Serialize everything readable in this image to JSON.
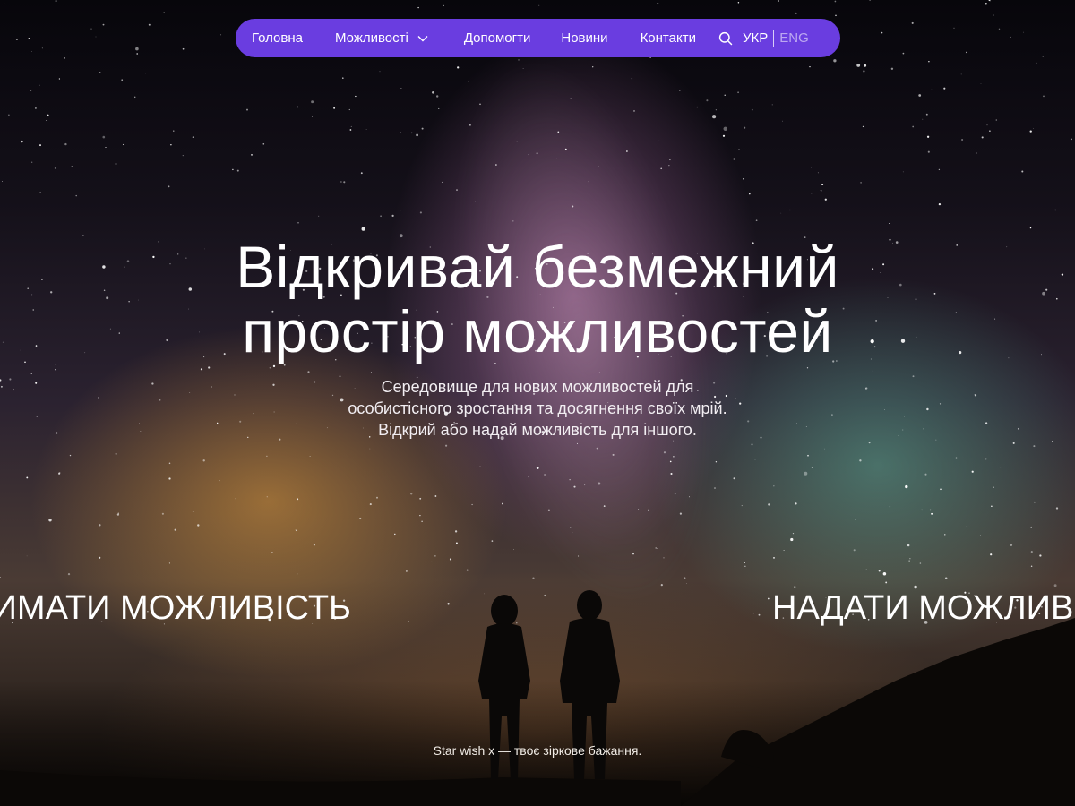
{
  "nav": {
    "items": [
      {
        "label": "Головна"
      },
      {
        "label": "Можливості"
      },
      {
        "label": "Допомогти"
      },
      {
        "label": "Новини"
      },
      {
        "label": "Контакти"
      }
    ],
    "languages": {
      "active": "УКР",
      "other": "ENG"
    },
    "accent_color": "#6a3de0"
  },
  "hero": {
    "headline_line1": "Відкривай безмежний",
    "headline_line2": "простір можливостей",
    "subtitle_line1": "Середовище для нових можливостей для",
    "subtitle_line2": "особистісного зростання та досягнення своїх мрій.",
    "subtitle_line3": "Відкрий або надай можливість для іншого.",
    "action_left": "ОТРИМАТИ МОЖЛИВІСТЬ",
    "action_right": "НАДАТИ МОЖЛИВІСТЬ",
    "footer_note": "Star wish x — твоє зіркове бажання."
  },
  "icons": {
    "search": "search-icon",
    "dropdown": "chevron-down-icon"
  }
}
